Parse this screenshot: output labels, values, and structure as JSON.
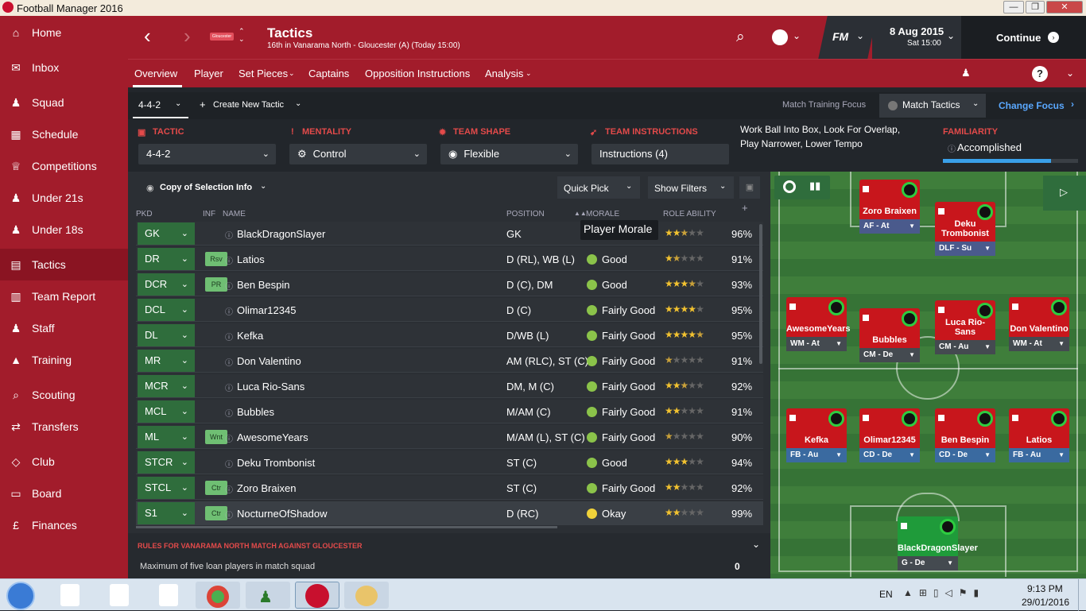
{
  "window": {
    "title": "Football Manager 2016",
    "min": "—",
    "max": "❐",
    "close": "✕"
  },
  "sidebar": [
    {
      "label": "Home",
      "icon": "home-icon",
      "glyph": "⌂"
    },
    {
      "label": "Inbox",
      "icon": "inbox-icon",
      "glyph": "✉"
    },
    {
      "label": "Squad",
      "icon": "squad-icon",
      "glyph": "♟"
    },
    {
      "label": "Schedule",
      "icon": "calendar-icon",
      "glyph": "▦"
    },
    {
      "label": "Competitions",
      "icon": "trophy-icon",
      "glyph": "♕"
    },
    {
      "label": "Under 21s",
      "icon": "u21-icon",
      "glyph": "♟"
    },
    {
      "label": "Under 18s",
      "icon": "u18-icon",
      "glyph": "♟"
    },
    {
      "label": "Tactics",
      "icon": "tactics-icon",
      "glyph": "▤"
    },
    {
      "label": "Team Report",
      "icon": "report-icon",
      "glyph": "▥"
    },
    {
      "label": "Staff",
      "icon": "staff-icon",
      "glyph": "♟"
    },
    {
      "label": "Training",
      "icon": "training-icon",
      "glyph": "▲"
    },
    {
      "label": "Scouting",
      "icon": "scouting-icon",
      "glyph": "⌕"
    },
    {
      "label": "Transfers",
      "icon": "transfers-icon",
      "glyph": "⇄"
    },
    {
      "label": "Club",
      "icon": "club-icon",
      "glyph": "◇"
    },
    {
      "label": "Board",
      "icon": "board-icon",
      "glyph": "▭"
    },
    {
      "label": "Finances",
      "icon": "finances-icon",
      "glyph": "£"
    }
  ],
  "header": {
    "title": "Tactics",
    "subtitle": "16th in Vanarama North - Gloucester (A) (Today 15:00)",
    "date": "8 Aug 2015",
    "time": "Sat 15:00",
    "continue": "Continue",
    "fm": "FM",
    "club_badge": "Gloucester"
  },
  "subnav": [
    "Overview",
    "Player",
    "Set Pieces",
    "Captains",
    "Opposition Instructions",
    "Analysis"
  ],
  "tactic_bar": {
    "formation": "4-4-2",
    "create": "Create New Tactic",
    "focus_label": "Match Training Focus",
    "focus_value": "Match Tactics",
    "change_focus": "Change Focus"
  },
  "instructions": {
    "tactic_label": "TACTIC",
    "tactic": "4-4-2",
    "mentality_label": "MENTALITY",
    "mentality": "Control",
    "shape_label": "TEAM SHAPE",
    "shape": "Flexible",
    "team_label": "TEAM INSTRUCTIONS",
    "team": "Instructions (4)",
    "summary": "Work Ball Into Box, Look For Overlap, Play Narrower, Lower Tempo",
    "familiarity_label": "FAMILIARITY",
    "familiarity": "Accomplished",
    "familiarity_level": 0.8
  },
  "list_toolbar": {
    "view": "Copy of Selection Info",
    "quick_pick": "Quick Pick",
    "show_filters": "Show Filters"
  },
  "columns": {
    "pkd": "PKD",
    "inf": "INF",
    "name": "NAME",
    "position": "POSITION",
    "morale": "MORALE",
    "role_ability": "ROLE ABILITY"
  },
  "tooltip": "Player Morale",
  "players": [
    {
      "pkd": "GK",
      "inf": "",
      "name": "BlackDragonSlayer",
      "position": "GK",
      "morale": "",
      "stars": 2.5,
      "ability": "96%"
    },
    {
      "pkd": "DR",
      "inf": "Rsv",
      "name": "Latios",
      "position": "D (RL), WB (L)",
      "morale": "Good",
      "stars": 1.5,
      "ability": "91%"
    },
    {
      "pkd": "DCR",
      "inf": "PR",
      "name": "Ben Bespin",
      "position": "D (C), DM",
      "morale": "Good",
      "stars": 3.5,
      "ability": "93%"
    },
    {
      "pkd": "DCL",
      "inf": "",
      "name": "Olimar12345",
      "position": "D (C)",
      "morale": "Fairly Good",
      "stars": 4,
      "ability": "95%"
    },
    {
      "pkd": "DL",
      "inf": "",
      "name": "Kefka",
      "position": "D/WB (L)",
      "morale": "Fairly Good",
      "stars": 4.5,
      "ability": "95%"
    },
    {
      "pkd": "MR",
      "inf": "",
      "name": "Don Valentino",
      "position": "AM (RLC), ST (C)",
      "morale": "Fairly Good",
      "stars": 0.5,
      "ability": "91%"
    },
    {
      "pkd": "MCR",
      "inf": "",
      "name": "Luca Rio-Sans",
      "position": "DM, M (C)",
      "morale": "Fairly Good",
      "stars": 2.5,
      "ability": "92%"
    },
    {
      "pkd": "MCL",
      "inf": "",
      "name": "Bubbles",
      "position": "M/AM (C)",
      "morale": "Fairly Good",
      "stars": 2,
      "ability": "91%"
    },
    {
      "pkd": "ML",
      "inf": "Wnt",
      "name": "AwesomeYears",
      "position": "M/AM (L), ST (C)",
      "morale": "Fairly Good",
      "stars": 0.5,
      "ability": "90%"
    },
    {
      "pkd": "STCR",
      "inf": "",
      "name": "Deku Trombonist",
      "position": "ST (C)",
      "morale": "Good",
      "stars": 3,
      "ability": "94%"
    },
    {
      "pkd": "STCL",
      "inf": "Ctr",
      "name": "Zoro Braixen",
      "position": "ST (C)",
      "morale": "Fairly Good",
      "stars": 2,
      "ability": "92%"
    },
    {
      "pkd": "S1",
      "inf": "Ctr",
      "name": "NocturneOfShadow",
      "position": "D (RC)",
      "morale": "Okay",
      "stars": 2,
      "ability": "99%"
    }
  ],
  "rules": {
    "heading": "RULES FOR VANARAMA NORTH MATCH AGAINST GLOUCESTER",
    "rule": "Maximum of five loan players in match squad",
    "value": "0"
  },
  "pitch": [
    {
      "name": "Zoro Braixen",
      "role": "AF - At",
      "gk": false
    },
    {
      "name": "Deku Trombonist",
      "role": "DLF - Su",
      "gk": false
    },
    {
      "name": "AwesomeYears",
      "role": "WM - At",
      "gk": false
    },
    {
      "name": "Bubbles",
      "role": "CM - De",
      "gk": false
    },
    {
      "name": "Luca Rio-Sans",
      "role": "CM - Au",
      "gk": false
    },
    {
      "name": "Don Valentino",
      "role": "WM - At",
      "gk": false
    },
    {
      "name": "Kefka",
      "role": "FB - Au",
      "gk": false
    },
    {
      "name": "Olimar12345",
      "role": "CD - De",
      "gk": false
    },
    {
      "name": "Ben Bespin",
      "role": "CD - De",
      "gk": false
    },
    {
      "name": "Latios",
      "role": "FB - Au",
      "gk": false
    },
    {
      "name": "BlackDragonSlayer",
      "role": "G - De",
      "gk": true
    }
  ],
  "taskbar": {
    "lang": "EN",
    "time": "9:13 PM",
    "date": "29/01/2016"
  }
}
